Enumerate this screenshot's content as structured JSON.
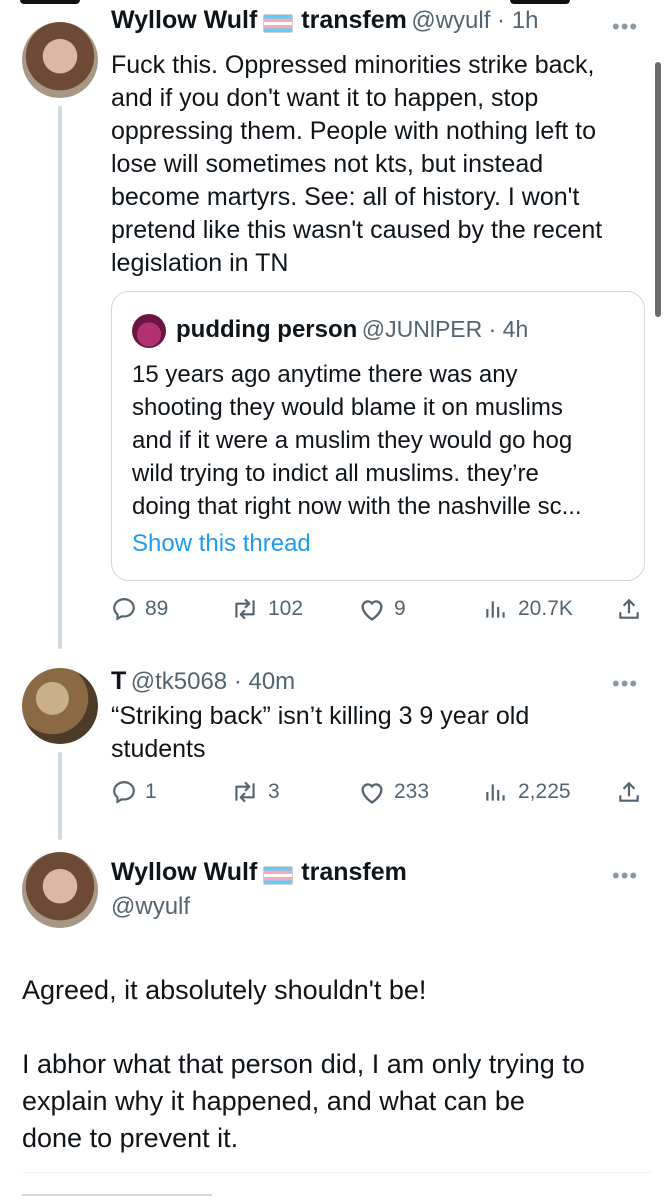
{
  "tweets": [
    {
      "name": "Wyllow Wulf",
      "tag": "transfem",
      "handle_time": "@wyulf · 1h",
      "text_lines": [
        "Fuck this. Oppressed minorities strike back,",
        "and if you don't want it to happen, stop",
        "oppressing them. People with nothing left to",
        "lose will sometimes not kts, but instead",
        "become martyrs. See: all of history. I won't",
        "pretend like this wasn't caused by the recent",
        "legislation in TN"
      ],
      "quote": {
        "name": "pudding person",
        "handle_time": "@JUNlPER · 4h",
        "text_lines": [
          "15 years ago anytime there was any",
          "shooting they would blame it on muslims",
          "and if it were a muslim they would go hog",
          "wild trying to indict all muslims.  they’re",
          "doing that right now with the nashville sc..."
        ],
        "show_thread": "Show this thread"
      },
      "actions": {
        "replies": "89",
        "retweets": "102",
        "likes": "9",
        "views": "20.7K"
      }
    },
    {
      "name": "T",
      "handle_time": "@tk5068 · 40m",
      "text_lines": [
        "“Striking back” isn’t killing 3 9 year old",
        "students"
      ],
      "actions": {
        "replies": "1",
        "retweets": "3",
        "likes": "233",
        "views": "2,225"
      }
    }
  ],
  "main_tweet": {
    "name": "Wyllow Wulf",
    "tag": "transfem",
    "handle": "@wyulf",
    "paragraphs": [
      "Agreed, it absolutely shouldn't be!",
      "I abhor what that person did, I am only trying to explain why it happened, and what can be done to prevent it."
    ],
    "text_lines": [
      "Agreed, it absolutely shouldn't be!",
      "I abhor what that person did, I am only trying to",
      "explain why it happened, and what can be",
      "done to prevent it."
    ]
  },
  "more_label": "•••",
  "colors": {
    "link": "#1d9bf0",
    "muted": "#536471",
    "line": "#cfd9de"
  },
  "icons": [
    "reply-icon",
    "retweet-icon",
    "like-icon",
    "views-icon",
    "share-icon",
    "more-icon",
    "trans-flag-icon"
  ]
}
